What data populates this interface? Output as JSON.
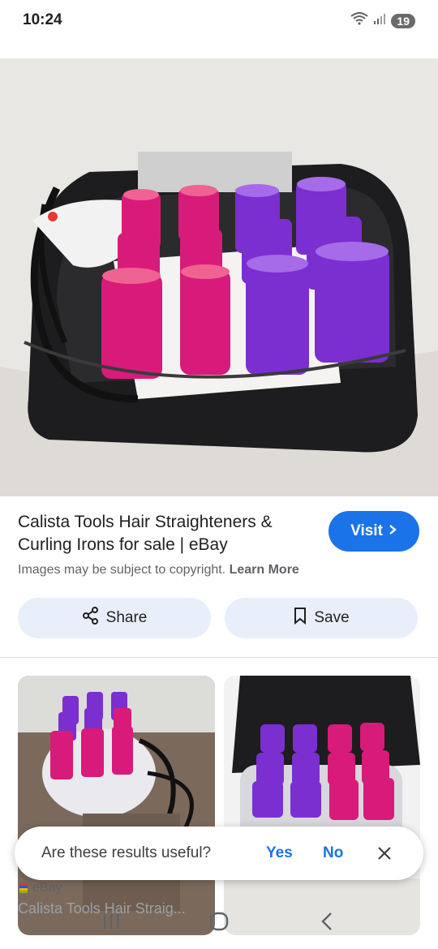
{
  "status_bar": {
    "time": "10:24",
    "battery": "19",
    "icons": [
      "wifi-icon",
      "signal-icon",
      "battery-icon"
    ]
  },
  "hero": {
    "image_name": "hair-rollers-set-image",
    "lens_icon": "google-lens-icon"
  },
  "result": {
    "title": "Calista Tools Hair Straighteners & Curling Irons for sale | eBay",
    "visit_label": "Visit",
    "copyright_text": "Images may be subject to copyright.",
    "learn_more": "Learn More"
  },
  "actions": {
    "share_label": "Share",
    "save_label": "Save"
  },
  "related": {
    "items": [
      {
        "source": "eBay",
        "title": "Calista Tools Hair Straig..."
      },
      {
        "source": "",
        "title": ""
      }
    ]
  },
  "feedback": {
    "question": "Are these results useful?",
    "yes": "Yes",
    "no": "No"
  },
  "colors": {
    "accent": "#1a73e8",
    "pill_bg": "#e8effb",
    "pink_roller": "#d81b7a",
    "purple_roller": "#7b2fd0"
  }
}
